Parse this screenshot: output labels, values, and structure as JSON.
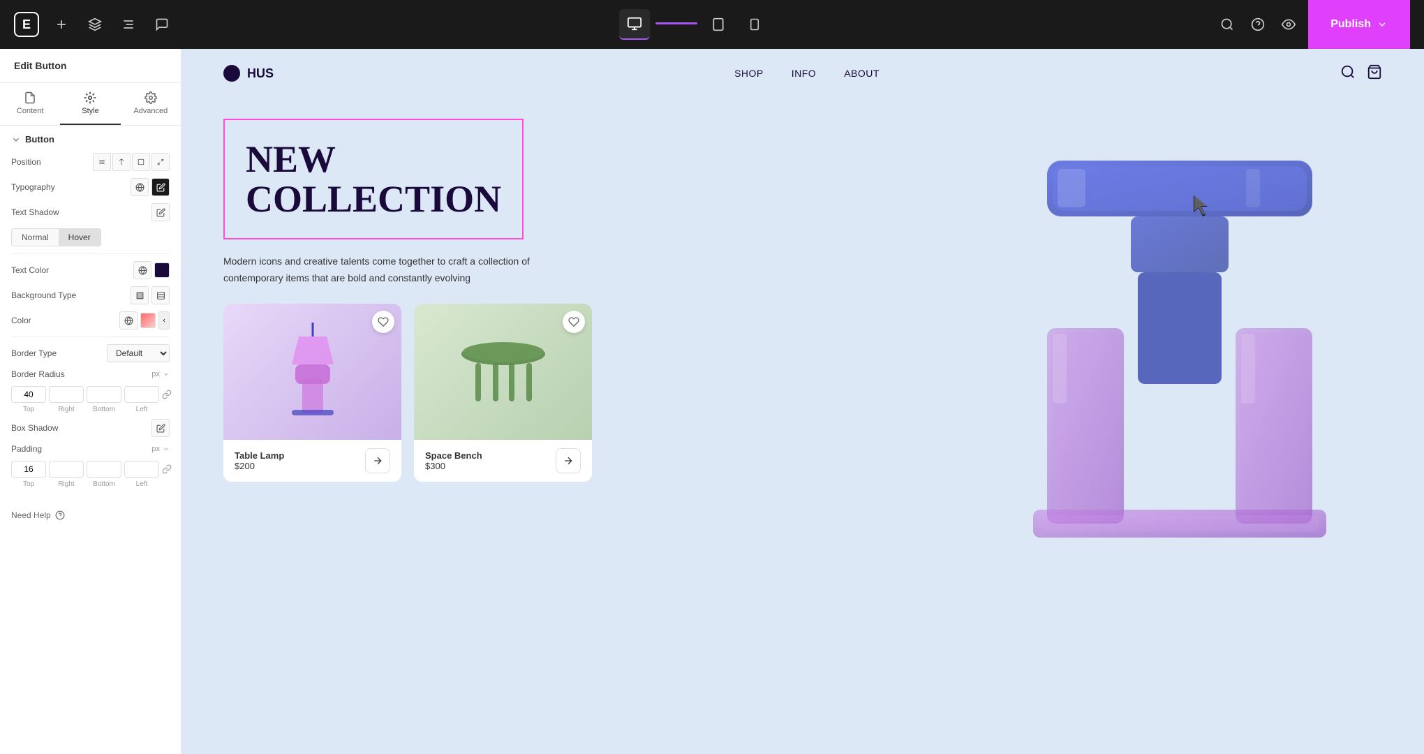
{
  "topbar": {
    "logo": "E",
    "publish_label": "Publish",
    "devices": [
      "desktop",
      "tablet",
      "mobile"
    ]
  },
  "panel": {
    "title": "Edit Button",
    "tabs": [
      {
        "id": "content",
        "label": "Content"
      },
      {
        "id": "style",
        "label": "Style"
      },
      {
        "id": "advanced",
        "label": "Advanced"
      }
    ],
    "section_button": "Button",
    "props": {
      "position_label": "Position",
      "typography_label": "Typography",
      "text_shadow_label": "Text Shadow",
      "text_color_label": "Text Color",
      "background_type_label": "Background Type",
      "color_label": "Color",
      "border_type_label": "Border Type",
      "border_type_value": "Default",
      "border_radius_label": "Border Radius",
      "border_radius_value": "40",
      "border_radius_right": "",
      "border_radius_bottom": "",
      "border_radius_left": "",
      "box_shadow_label": "Box Shadow",
      "padding_label": "Padding",
      "padding_value": "16",
      "padding_right": "",
      "padding_bottom": "",
      "padding_left": "",
      "unit_px": "px",
      "sublabels": [
        "Top",
        "Right",
        "Bottom",
        "Left"
      ],
      "toggle_normal": "Normal",
      "toggle_hover": "Hover"
    },
    "need_help": "Need Help"
  },
  "website": {
    "logo_text": "HUS",
    "nav_links": [
      "SHOP",
      "INFO",
      "ABOUT"
    ],
    "hero_heading_line1": "NEW",
    "hero_heading_line2": "COLLECTION",
    "hero_subtext": "Modern icons and creative talents come together to craft a collection of contemporary items that are bold and constantly evolving",
    "products": [
      {
        "name": "Table Lamp",
        "price": "$200"
      },
      {
        "name": "Space Bench",
        "price": "$300"
      }
    ]
  }
}
